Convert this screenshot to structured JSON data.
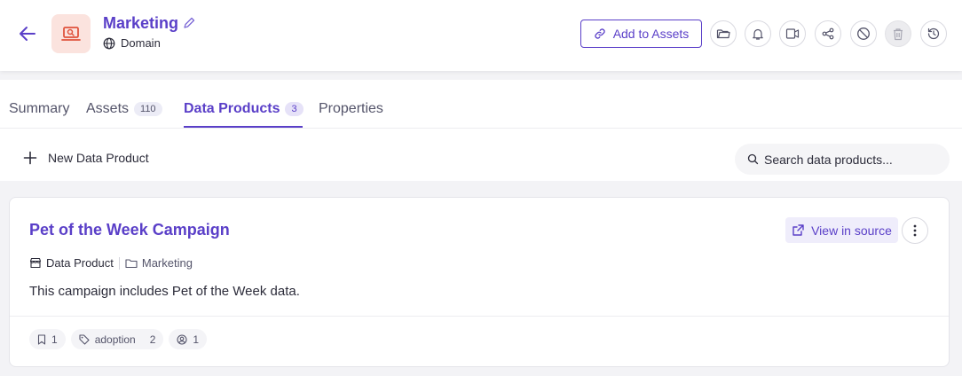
{
  "header": {
    "title": "Marketing",
    "entity_type": "Domain",
    "add_to_assets_label": "Add to Assets",
    "accent_color": "#5a3fc8",
    "icon_bg_color": "#fbe3de",
    "icon_color": "#e0533d",
    "action_icons": [
      "folder-icon",
      "bell-icon",
      "share-screen-icon",
      "share-icon",
      "block-icon",
      "trash-icon",
      "history-icon"
    ]
  },
  "tabs": [
    {
      "label": "Summary"
    },
    {
      "label": "Assets",
      "count": "110"
    },
    {
      "label": "Data Products",
      "count": "3",
      "active": true
    },
    {
      "label": "Properties"
    }
  ],
  "toolbar": {
    "new_label": "New Data Product",
    "search_placeholder": "Search data products..."
  },
  "card": {
    "title": "Pet of the Week Campaign",
    "view_source_label": "View in source",
    "type_label": "Data Product",
    "path_label": "Marketing",
    "description": "This campaign includes Pet of the Week data.",
    "chips": {
      "bookmark_count": "1",
      "tag_name": "adoption",
      "tag_count": "2",
      "owner_count": "1"
    }
  }
}
